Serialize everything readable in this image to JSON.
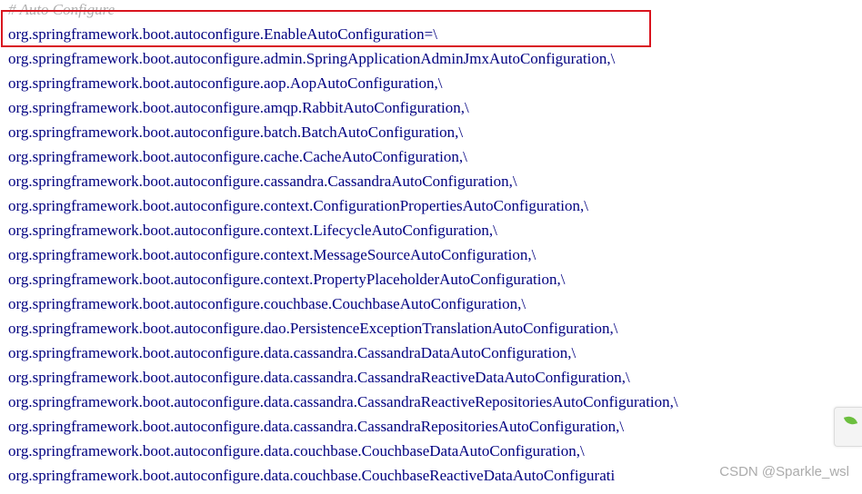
{
  "editor": {
    "comment": "# Auto Configure",
    "lines": [
      "org.springframework.boot.autoconfigure.EnableAutoConfiguration=\\",
      "org.springframework.boot.autoconfigure.admin.SpringApplicationAdminJmxAutoConfiguration,\\",
      "org.springframework.boot.autoconfigure.aop.AopAutoConfiguration,\\",
      "org.springframework.boot.autoconfigure.amqp.RabbitAutoConfiguration,\\",
      "org.springframework.boot.autoconfigure.batch.BatchAutoConfiguration,\\",
      "org.springframework.boot.autoconfigure.cache.CacheAutoConfiguration,\\",
      "org.springframework.boot.autoconfigure.cassandra.CassandraAutoConfiguration,\\",
      "org.springframework.boot.autoconfigure.context.ConfigurationPropertiesAutoConfiguration,\\",
      "org.springframework.boot.autoconfigure.context.LifecycleAutoConfiguration,\\",
      "org.springframework.boot.autoconfigure.context.MessageSourceAutoConfiguration,\\",
      "org.springframework.boot.autoconfigure.context.PropertyPlaceholderAutoConfiguration,\\",
      "org.springframework.boot.autoconfigure.couchbase.CouchbaseAutoConfiguration,\\",
      "org.springframework.boot.autoconfigure.dao.PersistenceExceptionTranslationAutoConfiguration,\\",
      "org.springframework.boot.autoconfigure.data.cassandra.CassandraDataAutoConfiguration,\\",
      "org.springframework.boot.autoconfigure.data.cassandra.CassandraReactiveDataAutoConfiguration,\\",
      "org.springframework.boot.autoconfigure.data.cassandra.CassandraReactiveRepositoriesAutoConfiguration,\\",
      "org.springframework.boot.autoconfigure.data.cassandra.CassandraRepositoriesAutoConfiguration,\\",
      "org.springframework.boot.autoconfigure.data.couchbase.CouchbaseDataAutoConfiguration,\\",
      "org.springframework.boot.autoconfigure.data.couchbase.CouchbaseReactiveDataAutoConfigurati"
    ]
  },
  "highlight_color": "#d9141e",
  "text_color": "#000080",
  "comment_color": "#b0b0b0",
  "side_widget_icon": "leaf-icon",
  "watermark": "CSDN @Sparkle_wsl"
}
